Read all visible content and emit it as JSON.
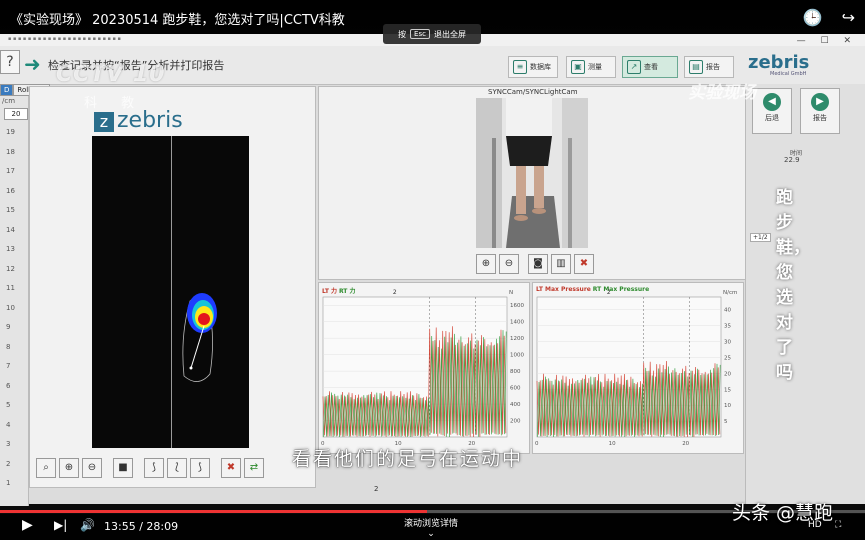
{
  "video": {
    "title": "《实验现场》 20230514 跑步鞋，您选对了吗|CCTV科教",
    "current_time": "13:55",
    "duration": "28:09",
    "time_display": "13:55 / 28:09",
    "progress": 0.494,
    "esc_hint": {
      "prefix": "按",
      "key": "Esc",
      "suffix": "退出全屏"
    },
    "scroll_hint": "滚动浏览详情",
    "subtitle": "看看他们的足弓在运动中",
    "vertical_caption": "跑步鞋，您选对了吗",
    "watermark": "头条 @慧跑"
  },
  "overlays": {
    "channel_logo": "CCTV 10",
    "channel_sub": "科 教",
    "program_logo": "实验现场"
  },
  "app": {
    "breadcrumb": "检查记录并按“报告”分析并打印报告",
    "toolbar": {
      "database": "数据库",
      "measure": "测量",
      "view": "查看",
      "report": "报告"
    },
    "brand": "zebris",
    "brand_sub": "Medical GmbH",
    "tabs": [
      "D",
      "Roll-offs"
    ],
    "scale_unit": "/cm",
    "scale_value": "20",
    "scale_ticks": [
      "19",
      "18",
      "17",
      "16",
      "15",
      "14",
      "13",
      "12",
      "11",
      "10",
      "9",
      "8",
      "7",
      "6",
      "5",
      "4",
      "3",
      "2",
      "1"
    ],
    "plate_logo": "zebris",
    "camera_label": "SYNCCam/SYNCLightCam",
    "sidebar": {
      "back": "后退",
      "report": "报告",
      "time_label": "时间",
      "time_value": "22.9",
      "page": "+1/2"
    },
    "bottom_chart_label": "2"
  },
  "charts_meta": {
    "left": {
      "lt": "LT 力",
      "rt": "RT 力",
      "unit": "N",
      "marker": "2"
    },
    "right": {
      "lt": "LT Max Pressure",
      "rt": "RT Max Pressure",
      "unit": "N/cm",
      "marker": "2"
    }
  },
  "chart_data": [
    {
      "type": "line",
      "title": "LT 力 RT 力",
      "ylabel": "N",
      "y_ticks": [
        200,
        400,
        600,
        800,
        1000,
        1200,
        1400,
        1600
      ],
      "ylim": [
        0,
        1700
      ],
      "x_ticks": [
        0,
        10,
        20
      ],
      "xlim": [
        0,
        25
      ],
      "series": [
        {
          "name": "LT 力",
          "color": "#d23a2a",
          "pattern": [
            {
              "from": 0,
              "to": 14.5,
              "low": 0,
              "high": 560
            },
            {
              "from": 14.5,
              "to": 25,
              "low": 0,
              "high": 1350
            }
          ]
        },
        {
          "name": "RT 力",
          "color": "#2e9a3a",
          "pattern": [
            {
              "from": 0,
              "to": 14.5,
              "low": 0,
              "high": 540
            },
            {
              "from": 14.5,
              "to": 25,
              "low": 0,
              "high": 1300
            }
          ]
        }
      ]
    },
    {
      "type": "line",
      "title": "LT Max Pressure RT Max Pressure",
      "ylabel": "N/cm",
      "y_ticks": [
        5,
        10,
        15,
        20,
        25,
        30,
        35,
        40
      ],
      "ylim": [
        0,
        44
      ],
      "x_ticks": [
        0,
        10,
        20
      ],
      "xlim": [
        0,
        25
      ],
      "series": [
        {
          "name": "LT Max Pressure",
          "color": "#d23a2a",
          "pattern": [
            {
              "from": 0,
              "to": 14.5,
              "low": 0,
              "high": 20
            },
            {
              "from": 14.5,
              "to": 25,
              "low": 0,
              "high": 24
            }
          ]
        },
        {
          "name": "RT Max Pressure",
          "color": "#2e9a3a",
          "pattern": [
            {
              "from": 0,
              "to": 14.5,
              "low": 0,
              "high": 19
            },
            {
              "from": 14.5,
              "to": 25,
              "low": 0,
              "high": 23
            }
          ]
        }
      ]
    }
  ],
  "colors": {
    "brand": "#2a6e8c",
    "accent_green": "#2e8b6b",
    "progress": "#e33333"
  }
}
